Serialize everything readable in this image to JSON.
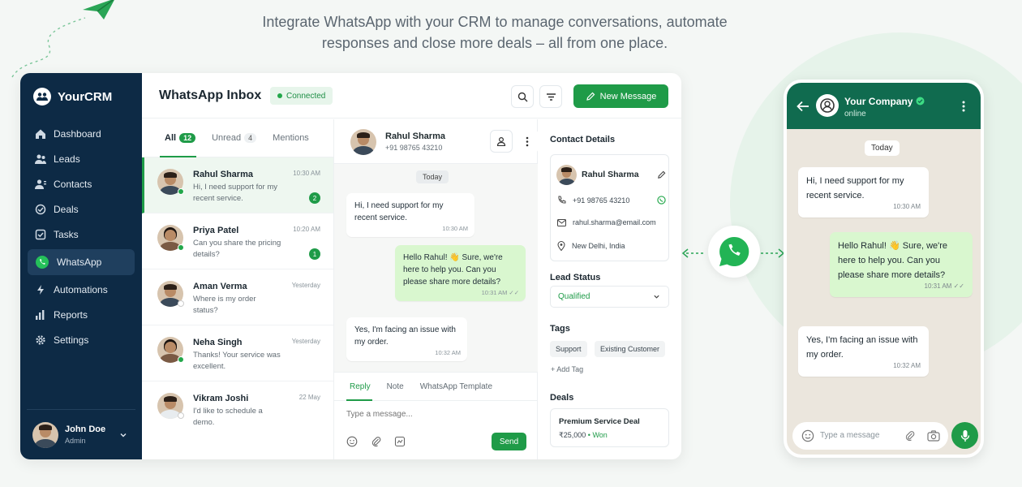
{
  "headline": "Integrate WhatsApp with your CRM to manage conversations, automate responses and close more deals – all from one place.",
  "app": {
    "brand": "YourCRM",
    "nav": [
      {
        "label": "Dashboard",
        "icon": "home-icon"
      },
      {
        "label": "Leads",
        "icon": "users-icon"
      },
      {
        "label": "Contacts",
        "icon": "contacts-icon"
      },
      {
        "label": "Deals",
        "icon": "deal-icon"
      },
      {
        "label": "Tasks",
        "icon": "checkbox-icon"
      },
      {
        "label": "WhatsApp",
        "icon": "whatsapp-icon",
        "active": true
      },
      {
        "label": "Automations",
        "icon": "automation-icon"
      },
      {
        "label": "Reports",
        "icon": "chart-icon"
      },
      {
        "label": "Settings",
        "icon": "gear-icon"
      }
    ],
    "user": {
      "name": "John Doe",
      "role": "Admin"
    },
    "header": {
      "title": "WhatsApp Inbox",
      "status": "Connected",
      "new_message": "New Message"
    },
    "tabs": {
      "all": "All",
      "all_count": "12",
      "unread": "Unread",
      "unread_count": "4",
      "mentions": "Mentions"
    },
    "conversations": [
      {
        "name": "Rahul Sharma",
        "preview": "Hi, I need support for my recent service.",
        "time": "10:30 AM",
        "unread": "2"
      },
      {
        "name": "Priya Patel",
        "preview": "Can you share the pricing details?",
        "time": "10:20 AM",
        "unread": "1"
      },
      {
        "name": "Aman Verma",
        "preview": "Where is my order status?",
        "time": "Yesterday",
        "unread": ""
      },
      {
        "name": "Neha Singh",
        "preview": "Thanks! Your service was excellent.",
        "time": "Yesterday",
        "unread": ""
      },
      {
        "name": "Vikram Joshi",
        "preview": "I'd like to schedule a demo.",
        "time": "22 May",
        "unread": ""
      }
    ],
    "chat": {
      "name": "Rahul Sharma",
      "phone": "+91 98765 43210",
      "day": "Today",
      "messages": [
        {
          "text": "Hi, I need support for my recent service.",
          "time": "10:30 AM",
          "dir": "in"
        },
        {
          "text": "Hello Rahul! 👋 Sure, we're here to help you. Can you please share more details?",
          "time": "10:31 AM",
          "dir": "out"
        },
        {
          "text": "Yes, I'm facing an issue with my order.",
          "time": "10:32 AM",
          "dir": "in"
        }
      ],
      "reply_tabs": [
        "Reply",
        "Note",
        "WhatsApp Template"
      ],
      "placeholder": "Type a message...",
      "send": "Send"
    },
    "details": {
      "title": "Contact Details",
      "name": "Rahul Sharma",
      "phone": "+91 98765 43210",
      "email": "rahul.sharma@email.com",
      "location": "New Delhi, India",
      "lead_status_label": "Lead Status",
      "lead_status": "Qualified",
      "tags_label": "Tags",
      "tags": [
        "Support",
        "Existing Customer"
      ],
      "add_tag": "+ Add Tag",
      "deals_label": "Deals",
      "deal_name": "Premium Service Deal",
      "deal_amount": "₹25,000",
      "deal_status": "Won"
    }
  },
  "phone": {
    "company": "Your Company",
    "status": "online",
    "day": "Today",
    "messages": [
      {
        "text": "Hi, I need support for my recent service.",
        "time": "10:30 AM"
      },
      {
        "text": "Hello Rahul! 👋 Sure, we're here to help you. Can you please share more details?",
        "time": "10:31 AM"
      },
      {
        "text": "Yes, I'm facing an issue with my order.",
        "time": "10:32 AM"
      }
    ],
    "placeholder": "Type a message"
  },
  "colors": {
    "brand_green": "#1f9b48",
    "sidebar": "#0d2a45",
    "phone_header": "#106b4f"
  }
}
